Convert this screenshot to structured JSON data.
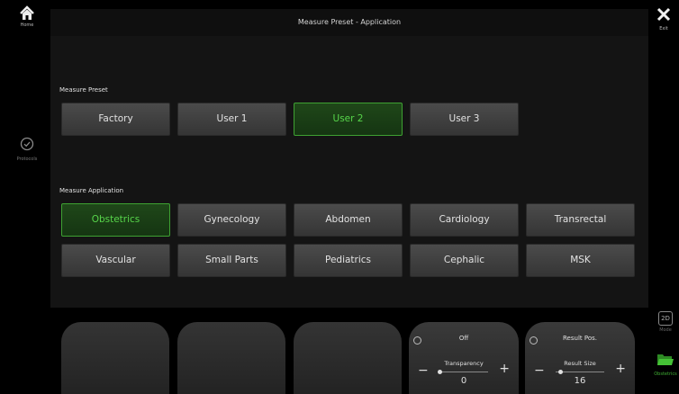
{
  "nav": {
    "home_label": "Home",
    "protocols_label": "Protocols",
    "exit_label": "Exit",
    "mode_box": "2D",
    "mode_label": "Mode",
    "obstetrics_label": "Obstetrics"
  },
  "title": "Measure Preset - Application",
  "preset": {
    "label": "Measure Preset",
    "items": [
      {
        "label": "Factory",
        "selected": false
      },
      {
        "label": "User 1",
        "selected": false
      },
      {
        "label": "User 2",
        "selected": true
      },
      {
        "label": "User 3",
        "selected": false
      }
    ]
  },
  "application": {
    "label": "Measure Application",
    "items": [
      {
        "label": "Obstetrics",
        "selected": true
      },
      {
        "label": "Gynecology",
        "selected": false
      },
      {
        "label": "Abdomen",
        "selected": false
      },
      {
        "label": "Cardiology",
        "selected": false
      },
      {
        "label": "Transrectal",
        "selected": false
      },
      {
        "label": "Vascular",
        "selected": false
      },
      {
        "label": "Small Parts",
        "selected": false
      },
      {
        "label": "Pediatrics",
        "selected": false
      },
      {
        "label": "Cephalic",
        "selected": false
      },
      {
        "label": "MSK",
        "selected": false
      }
    ]
  },
  "knobs": [
    {
      "top": "Off",
      "label": "Transparency",
      "value": "0",
      "level": 0.0
    },
    {
      "top": "Result Pos.",
      "label": "Result Size",
      "value": "16",
      "level": 0.1
    }
  ],
  "colors": {
    "accent_green": "#3ea132",
    "selected_text": "#57d54a",
    "button_bg": "#404040",
    "panel_bg": "#141414"
  },
  "icons": {
    "home": "home-icon",
    "protocols": "check-circle-icon",
    "exit": "close-icon",
    "mode": "2d-mode-icon",
    "folder": "folder-icon"
  }
}
